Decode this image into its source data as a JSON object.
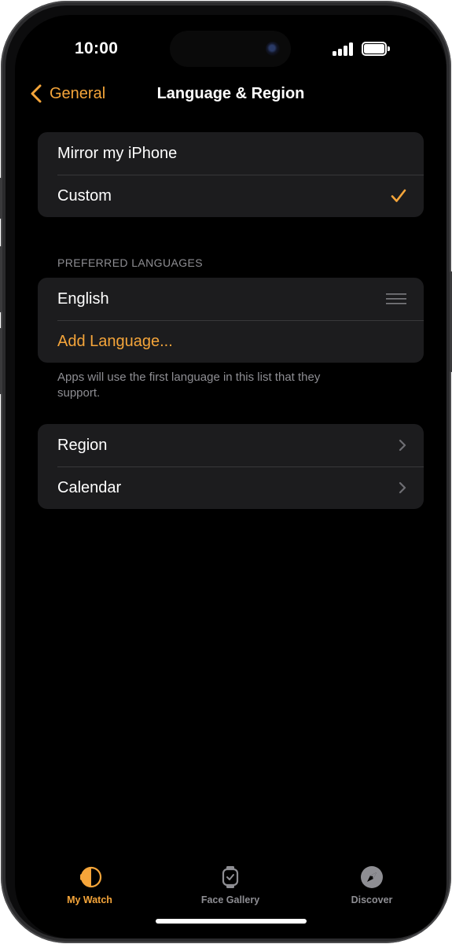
{
  "status_bar": {
    "time": "10:00",
    "signal_icon": "cellular-signal-icon",
    "battery_icon": "battery-full-icon"
  },
  "nav": {
    "back_label": "General",
    "back_icon": "chevron-left-icon",
    "title": "Language & Region"
  },
  "language_mode": {
    "options": [
      {
        "label": "Mirror my iPhone",
        "selected": false
      },
      {
        "label": "Custom",
        "selected": true
      }
    ],
    "checkmark_icon": "checkmark-icon"
  },
  "preferred_languages": {
    "header": "PREFERRED LANGUAGES",
    "items": [
      {
        "label": "English",
        "reorder_icon": "reorder-handle-icon"
      }
    ],
    "add_label": "Add Language...",
    "footer": "Apps will use the first language in this list that they support."
  },
  "format_settings": {
    "items": [
      {
        "label": "Region",
        "icon": "chevron-right-icon"
      },
      {
        "label": "Calendar",
        "icon": "chevron-right-icon"
      }
    ]
  },
  "tab_bar": {
    "tabs": [
      {
        "label": "My Watch",
        "icon": "my-watch-icon",
        "active": true
      },
      {
        "label": "Face Gallery",
        "icon": "face-gallery-icon",
        "active": false
      },
      {
        "label": "Discover",
        "icon": "discover-compass-icon",
        "active": false
      }
    ]
  },
  "colors": {
    "accent": "#f5a53a",
    "background": "#000000",
    "group_background": "#1c1c1e",
    "secondary_text": "#8e8e93",
    "separator": "#38383a"
  }
}
